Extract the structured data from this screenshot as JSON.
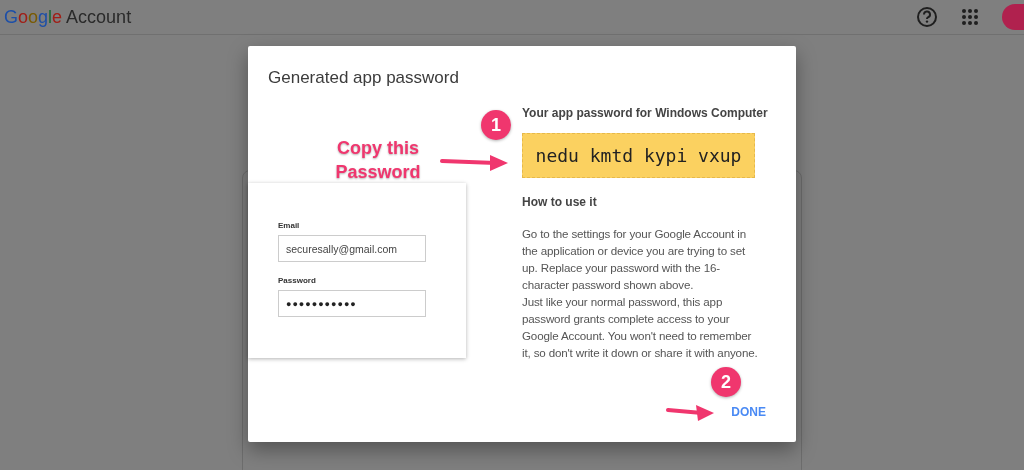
{
  "header": {
    "logo_word": "Google",
    "logo_suffix": "Account"
  },
  "dialog": {
    "title": "Generated app password",
    "password_label": "Your app password for Windows Computer",
    "app_password": "nedu kmtd kypi vxup",
    "how_title": "How to use it",
    "paragraphs": [
      "Go to the settings for your Google Account in the application or device you are trying to set up. Replace your password with the 16-character password shown above.",
      "Just like your normal password, this app password grants complete access to your Google Account. You won't need to remember it, so don't write it down or share it with anyone."
    ],
    "done_button": "DONE"
  },
  "login_card": {
    "fields": [
      {
        "label": "Email",
        "value": "securesally@gmail.com"
      },
      {
        "label": "Password",
        "value": "●●●●●●●●●●●"
      }
    ]
  },
  "annotations": {
    "callout": "Copy this Password",
    "steps": [
      "1",
      "2"
    ]
  }
}
